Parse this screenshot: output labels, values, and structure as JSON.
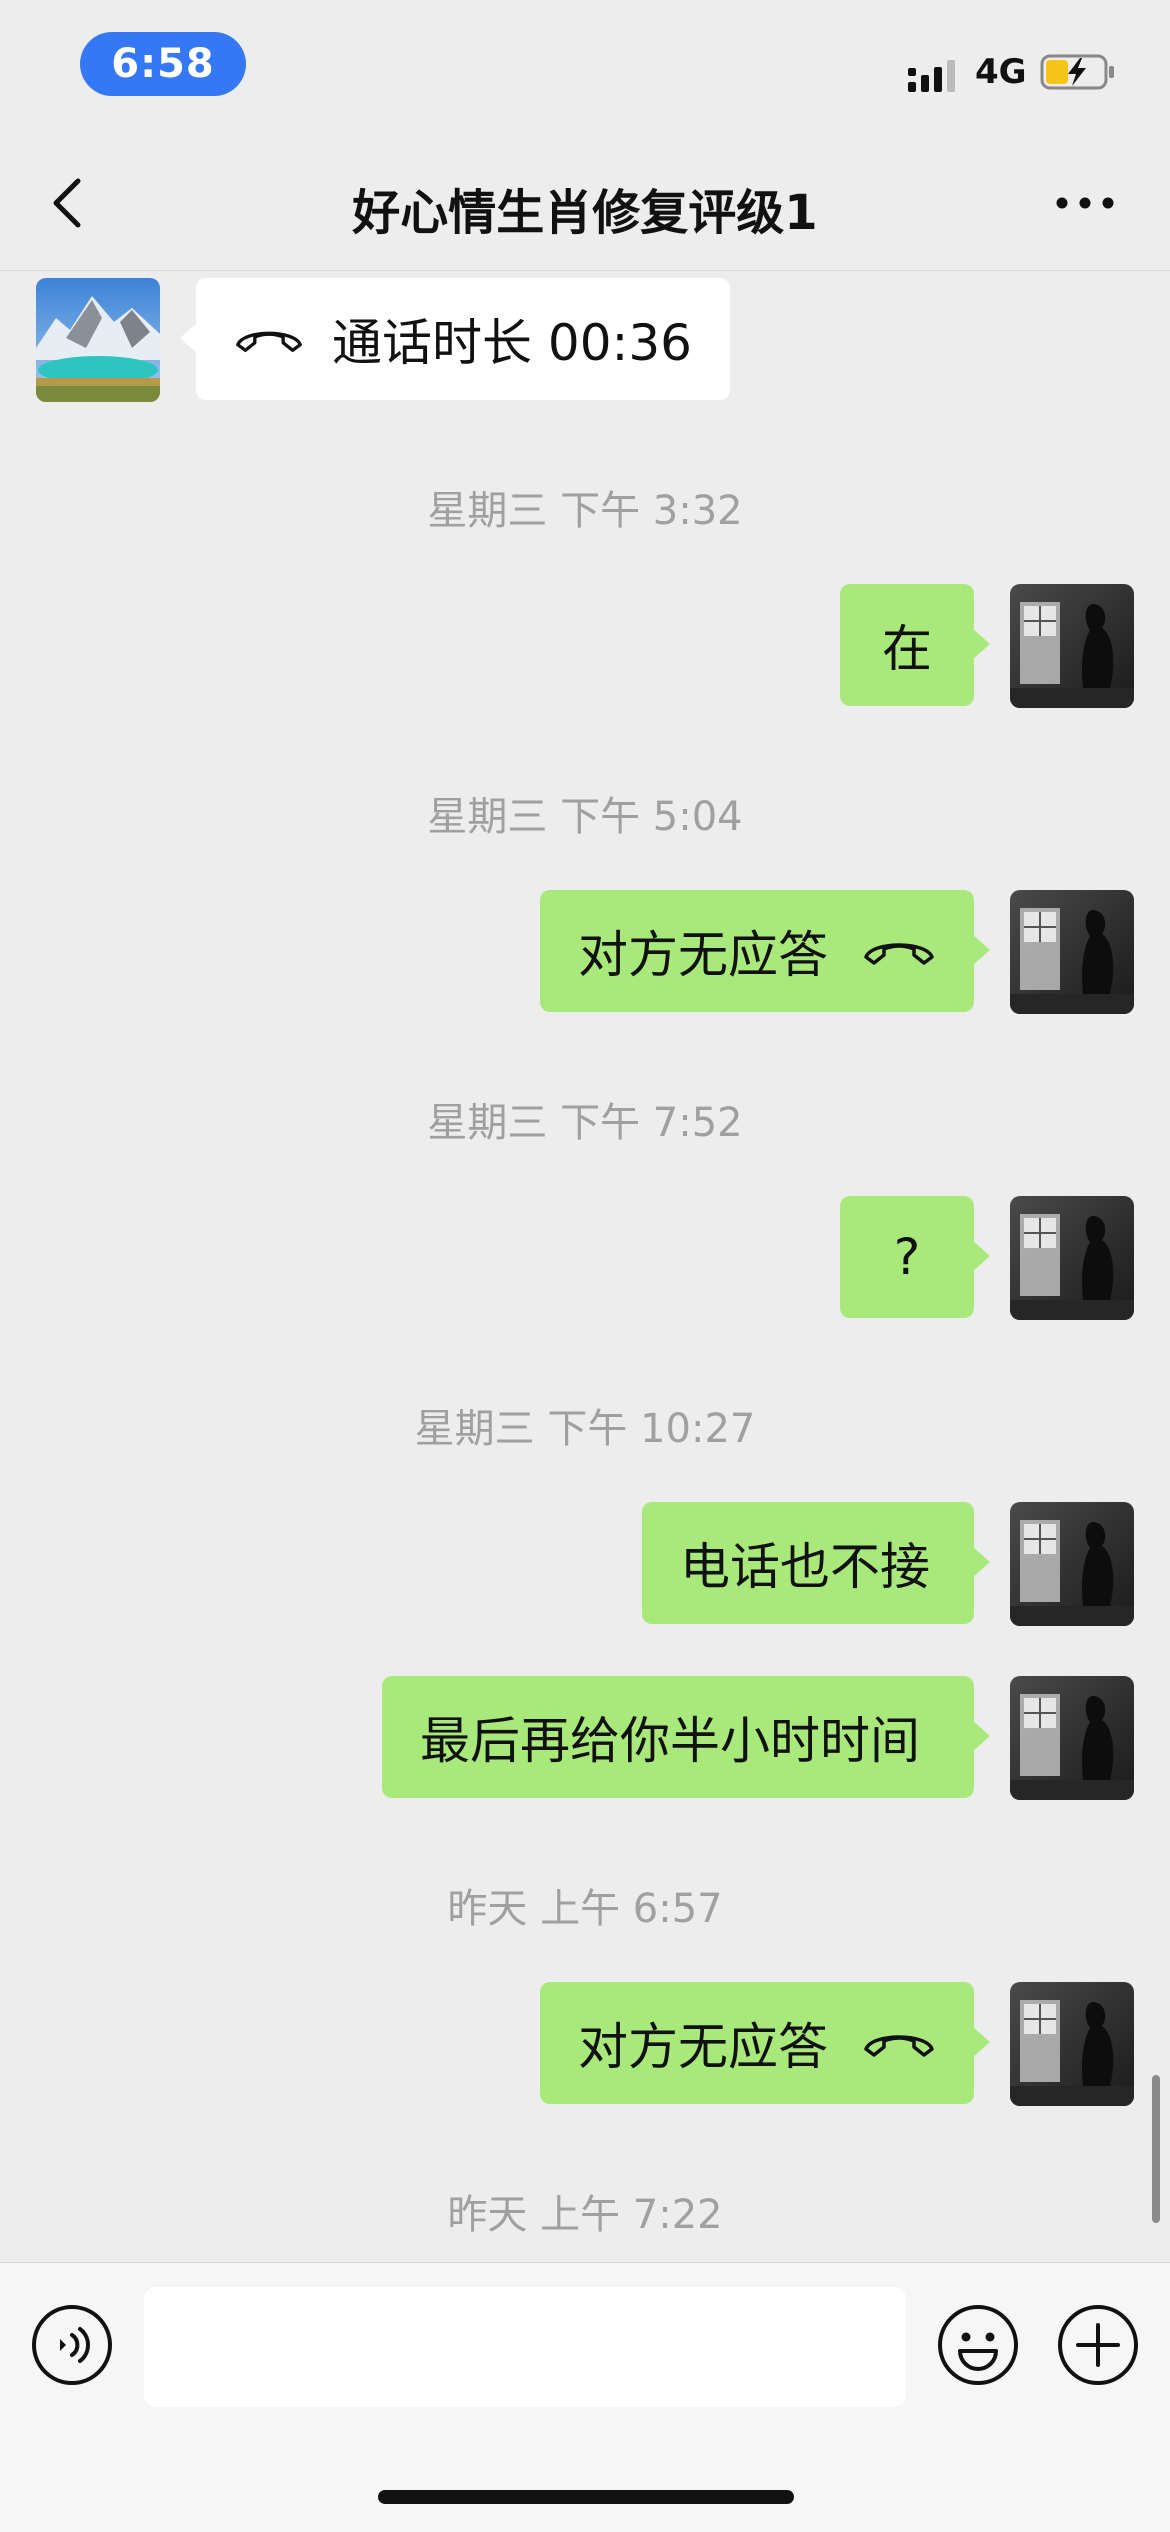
{
  "status_bar": {
    "time": "6:58",
    "network": "4G",
    "icons": [
      "signal-icon",
      "battery-charging-icon"
    ]
  },
  "nav": {
    "title": "好心情生肖修复评级1",
    "icons": [
      "back-chevron-icon",
      "more-dots-icon"
    ]
  },
  "messages": [
    {
      "kind": "call",
      "side": "left",
      "text": "通话时长 00:36",
      "icon": "phone-hangup-icon"
    },
    {
      "kind": "timestamp",
      "text": "星期三 下午 3:32"
    },
    {
      "kind": "text",
      "side": "right",
      "text": "在"
    },
    {
      "kind": "timestamp",
      "text": "星期三 下午 5:04"
    },
    {
      "kind": "call",
      "side": "right",
      "text": "对方无应答",
      "icon": "phone-hangup-icon"
    },
    {
      "kind": "timestamp",
      "text": "星期三 下午 7:52"
    },
    {
      "kind": "text",
      "side": "right",
      "text": "?"
    },
    {
      "kind": "timestamp",
      "text": "星期三 下午 10:27"
    },
    {
      "kind": "text",
      "side": "right",
      "text": "电话也不接"
    },
    {
      "kind": "text",
      "side": "right",
      "text": "最后再给你半小时时间"
    },
    {
      "kind": "timestamp",
      "text": "昨天 上午 6:57"
    },
    {
      "kind": "call",
      "side": "right",
      "text": "对方无应答",
      "icon": "phone-hangup-icon"
    },
    {
      "kind": "timestamp",
      "text": "昨天 上午 7:22"
    }
  ],
  "input_bar": {
    "value": "",
    "icons": [
      "voice-icon",
      "emoji-icon",
      "plus-icon"
    ]
  },
  "colors": {
    "background": "#ededed",
    "bubble_green": "#a9e97c",
    "bubble_white": "#ffffff",
    "time_pill": "#3478f6",
    "timestamp_text": "#a0a0a0"
  }
}
